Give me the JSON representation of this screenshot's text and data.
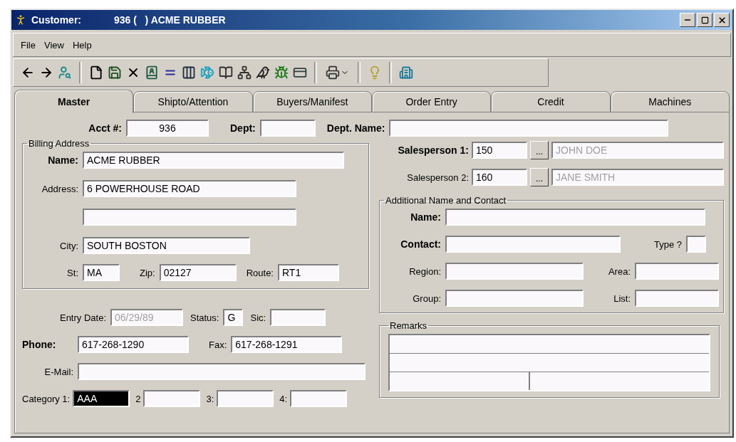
{
  "window": {
    "title": "Customer:",
    "record": "936 (   ) ACME RUBBER"
  },
  "menu": [
    "File",
    "View",
    "Help"
  ],
  "tabs": [
    {
      "label": "Master",
      "selected": true
    },
    {
      "label": "Shipto/Attention",
      "selected": false
    },
    {
      "label": "Buyers/Manifest",
      "selected": false
    },
    {
      "label": "Order Entry",
      "selected": false
    },
    {
      "label": "Credit",
      "selected": false
    },
    {
      "label": "Machines",
      "selected": false
    }
  ],
  "header": {
    "acct": {
      "label": "Acct #:",
      "value": "936",
      "required": true
    },
    "dept": {
      "label": "Dept:",
      "required": true
    },
    "dept_name": {
      "label": "Dept. Name:",
      "required": true
    }
  },
  "billing_address": {
    "title": "Billing Address",
    "name": {
      "label": "Name:",
      "value": "ACME RUBBER",
      "required": true
    },
    "address": {
      "label": "Address:",
      "lines": [
        "6 POWERHOUSE ROAD"
      ],
      "required": false
    },
    "city": {
      "label": "City:",
      "value": "SOUTH BOSTON",
      "required": false
    },
    "st": {
      "label": "St:",
      "value": "MA",
      "required": false
    },
    "zip": {
      "label": "Zip:",
      "value": "02127",
      "required": false
    },
    "route": {
      "label": "Route:",
      "value": "RT1",
      "required": false
    }
  },
  "entry_date": {
    "label": "Entry Date:",
    "value": "06/29/89",
    "disabled": true
  },
  "status": {
    "label": "Status:",
    "value": "G"
  },
  "sic": {
    "label": "Sic:"
  },
  "phone": {
    "label": "Phone:",
    "value": "617-268-1290",
    "required": true
  },
  "fax": {
    "label": "Fax:",
    "value": "617-268-1291",
    "required": false
  },
  "email": {
    "label": "E-Mail:",
    "required": false
  },
  "categories": [
    {
      "label": "Category 1:",
      "value": "AAA",
      "selected": true
    },
    {
      "label": "2",
      "selected": false
    },
    {
      "label": "3:",
      "selected": false
    },
    {
      "label": "4:",
      "selected": false
    }
  ],
  "salespersons": [
    {
      "label": "Salesperson 1:",
      "code": "150",
      "button": "...",
      "name": "JOHN DOE",
      "required": true
    },
    {
      "label": "Salesperson 2:",
      "code": "160",
      "button": "...",
      "name": "JANE SMITH",
      "required": false
    }
  ],
  "additional_contact": {
    "title": "Additional Name and Contact",
    "name": {
      "label": "Name:",
      "required": true
    },
    "contact": {
      "label": "Contact:",
      "required": true
    },
    "type": {
      "label": "Type ?",
      "required": false
    },
    "region": {
      "label": "Region:",
      "required": false
    },
    "area": {
      "label": "Area:",
      "required": false
    },
    "group": {
      "label": "Group:",
      "required": false
    },
    "list": {
      "label": "List:",
      "required": false
    }
  },
  "remarks": {
    "title": "Remarks"
  }
}
